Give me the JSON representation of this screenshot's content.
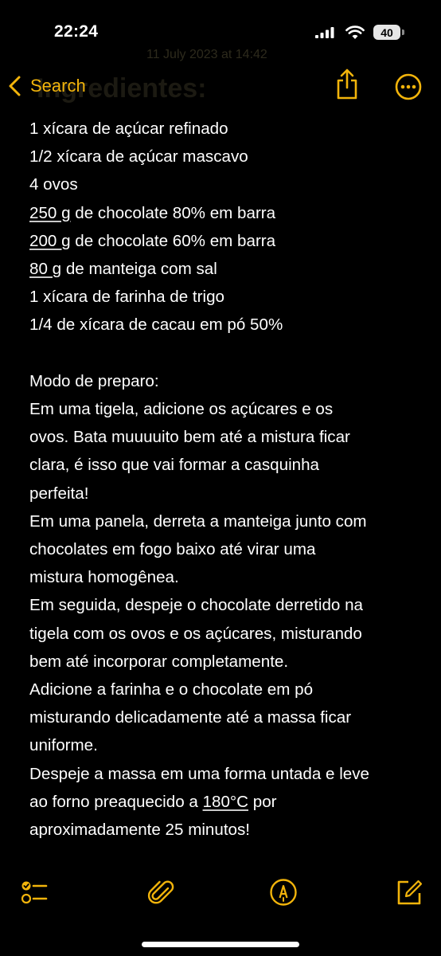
{
  "status_bar": {
    "time": "22:24",
    "battery": "40",
    "icons": [
      "cellular-signal-icon",
      "wifi-icon",
      "battery-icon"
    ]
  },
  "ghost": {
    "date": "11 July 2023 at 14:42",
    "title": "Ingredientes:"
  },
  "nav": {
    "back_label": "Search",
    "accent_color": "#f2b40b",
    "icons": [
      "chevron-left-icon",
      "share-icon",
      "more-icon"
    ]
  },
  "note": {
    "ingredients": [
      {
        "pre": "",
        "u": "",
        "post": "1 xícara de açúcar refinado"
      },
      {
        "pre": "",
        "u": "",
        "post": "1/2 xícara de açúcar mascavo"
      },
      {
        "pre": "",
        "u": "",
        "post": "4 ovos"
      },
      {
        "pre": "",
        "u": "250 g",
        "post": " de chocolate 80% em barra"
      },
      {
        "pre": "",
        "u": "200 g",
        "post": " de chocolate 60% em barra"
      },
      {
        "pre": "",
        "u": "80 g",
        "post": " de manteiga com sal"
      },
      {
        "pre": "",
        "u": "",
        "post": "1 xícara de farinha de trigo"
      },
      {
        "pre": "",
        "u": "",
        "post": "1/4 de xícara de cacau em pó 50%"
      }
    ],
    "method_lines": [
      {
        "pre": "",
        "u": "",
        "post": "Modo de preparo:"
      },
      {
        "pre": "",
        "u": "",
        "post": "Em uma tigela, adicione os açúcares e os"
      },
      {
        "pre": "",
        "u": "",
        "post": "ovos. Bata muuuuito bem até a mistura ficar"
      },
      {
        "pre": "",
        "u": "",
        "post": "clara, é isso que vai formar a casquinha"
      },
      {
        "pre": "",
        "u": "",
        "post": "perfeita!"
      },
      {
        "pre": "",
        "u": "",
        "post": "Em uma panela, derreta a manteiga junto com"
      },
      {
        "pre": "",
        "u": "",
        "post": "chocolates em fogo baixo até virar uma"
      },
      {
        "pre": "",
        "u": "",
        "post": "mistura homogênea."
      },
      {
        "pre": "",
        "u": "",
        "post": "Em seguida, despeje o chocolate derretido na"
      },
      {
        "pre": "",
        "u": "",
        "post": "tigela com os ovos e os açúcares, misturando"
      },
      {
        "pre": "",
        "u": "",
        "post": "bem até incorporar completamente."
      },
      {
        "pre": "",
        "u": "",
        "post": "Adicione a farinha e o chocolate em pó"
      },
      {
        "pre": "",
        "u": "",
        "post": "misturando delicadamente até a massa ficar"
      },
      {
        "pre": "",
        "u": "",
        "post": "uniforme."
      },
      {
        "pre": "",
        "u": "",
        "post": "Despeje a massa em uma forma untada e leve"
      },
      {
        "pre": "ao forno preaquecido a ",
        "u": "180°C",
        "post": " por"
      },
      {
        "pre": "",
        "u": "",
        "post": "aproximadamente 25 minutos!"
      }
    ]
  },
  "toolbar": {
    "icons": [
      "checklist-icon",
      "attachment-icon",
      "markup-icon",
      "compose-icon"
    ]
  }
}
